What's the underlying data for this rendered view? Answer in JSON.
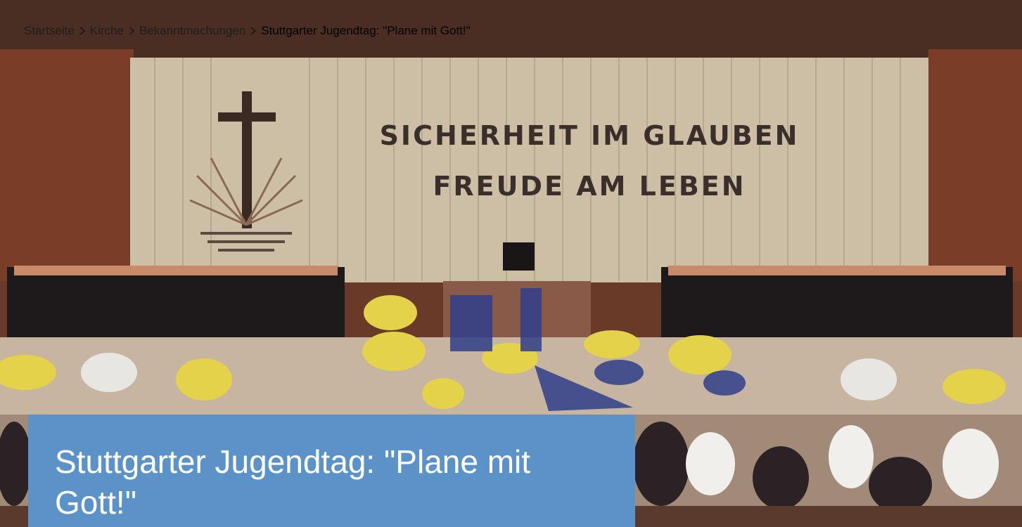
{
  "hero": {
    "wall_line_1": "SICHERHEIT IM GLAUBEN",
    "wall_line_2": "FREUDE AM LEBEN",
    "colors": {
      "wall": "#c9bca4",
      "brick": "#7a3d28",
      "floor": "#c7b4a1",
      "flowers_yellow": "#e6d84a",
      "flowers_blue": "#2f3f8a"
    }
  },
  "breadcrumb": {
    "items": [
      {
        "label": "Startseite"
      },
      {
        "label": "Kirche"
      },
      {
        "label": "Bekanntmachungen"
      }
    ],
    "current": "Stuttgarter Jugendtag: \"Plane mit Gott!\"",
    "separator_icon": "chevron-right-icon"
  },
  "article": {
    "title": "Stuttgarter Jugendtag: \"Plane mit Gott!\"",
    "title_box_color": "#5b93c9"
  }
}
